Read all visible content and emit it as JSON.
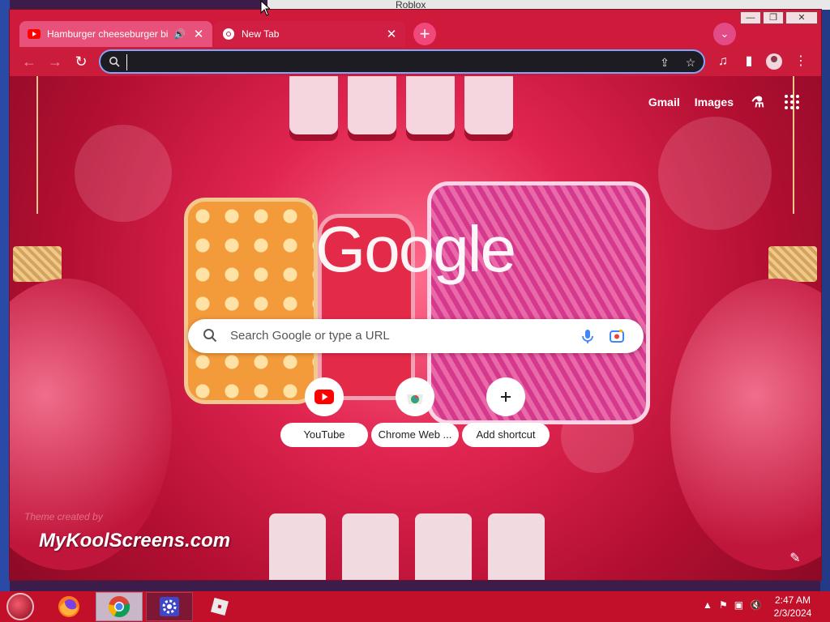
{
  "background_window": {
    "title": "Roblox"
  },
  "tabs": [
    {
      "title": "Hamburger cheeseburger bi",
      "favicon": "youtube-icon",
      "audio": "speaker-icon",
      "close": "✕"
    },
    {
      "title": "New Tab",
      "favicon": "chrome-icon",
      "close": "✕"
    }
  ],
  "toolbar": {
    "omnibox_value": "",
    "icons": [
      "back-icon",
      "forward-icon",
      "reload-icon",
      "share-icon",
      "bookmark-star-icon",
      "media-icon",
      "side-panel-icon",
      "profile-icon",
      "menu-icon"
    ]
  },
  "ntp": {
    "links": {
      "gmail": "Gmail",
      "images": "Images"
    },
    "logo": "Google",
    "search_placeholder": "Search Google or type a URL",
    "shortcuts": [
      {
        "label": "YouTube",
        "icon": "youtube-icon"
      },
      {
        "label": "Chrome Web ...",
        "icon": "chrome-web-store-icon"
      },
      {
        "label": "Add shortcut",
        "icon": "plus-icon"
      }
    ],
    "theme_credit": "Theme created by",
    "theme_brand": "MyKoolScreens.com"
  },
  "taskbar": {
    "apps": [
      "firefox-icon",
      "chrome-icon",
      "settings-icon",
      "roblox-icon"
    ],
    "time": "2:47 AM",
    "date": "2/3/2024"
  },
  "colors": {
    "frame": "#cf1b3d",
    "omnibox": "#1c1c22",
    "taskbar": "#c3102a",
    "focus_ring": "#7fa6ff"
  }
}
